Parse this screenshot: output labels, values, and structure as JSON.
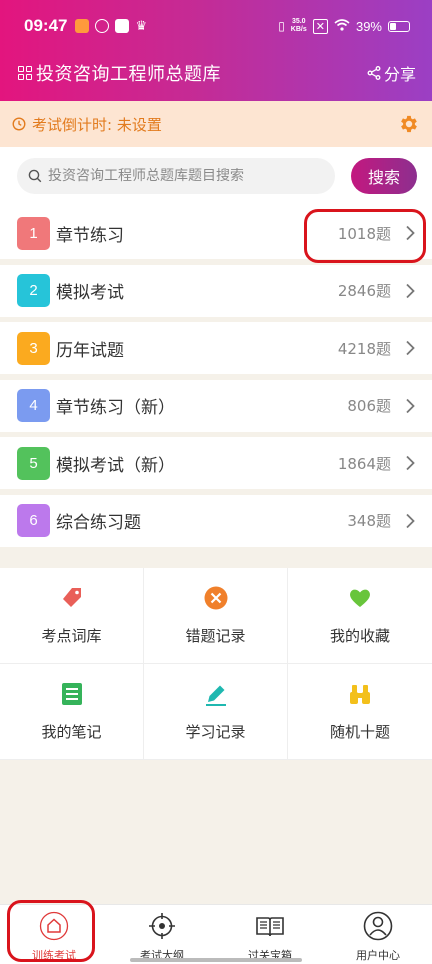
{
  "status_bar": {
    "time": "09:47",
    "net_speed_top": "35.0",
    "net_speed_bottom": "KB/s",
    "battery": "39%"
  },
  "app_bar": {
    "title": "投资咨询工程师总题库",
    "share_label": "分享"
  },
  "countdown": {
    "text": "考试倒计时: 未设置"
  },
  "search": {
    "placeholder": "投资咨询工程师总题库题目搜索",
    "button_label": "搜索"
  },
  "menu": {
    "items": [
      {
        "number": "1",
        "label": "章节练习",
        "count": "1018题",
        "color": "#f0787a"
      },
      {
        "number": "2",
        "label": "模拟考试",
        "count": "2846题",
        "color": "#26c4d9"
      },
      {
        "number": "3",
        "label": "历年试题",
        "count": "4218题",
        "color": "#fbaa1f"
      },
      {
        "number": "4",
        "label": "章节练习（新）",
        "count": "806题",
        "color": "#7b9bf0"
      },
      {
        "number": "5",
        "label": "模拟考试（新）",
        "count": "1864题",
        "color": "#53c25c"
      },
      {
        "number": "6",
        "label": "综合练习题",
        "count": "348题",
        "color": "#bc79ec"
      }
    ]
  },
  "tools": {
    "items": [
      {
        "label": "考点词库",
        "icon": "tag-icon"
      },
      {
        "label": "错题记录",
        "icon": "wrong-x-icon"
      },
      {
        "label": "我的收藏",
        "icon": "heart-icon"
      },
      {
        "label": "我的笔记",
        "icon": "notes-icon"
      },
      {
        "label": "学习记录",
        "icon": "pencil-icon"
      },
      {
        "label": "随机十题",
        "icon": "binoculars-icon"
      }
    ]
  },
  "tabbar": {
    "items": [
      {
        "label": "训练考试",
        "icon": "home-icon",
        "active": true
      },
      {
        "label": "考试大纲",
        "icon": "target-icon"
      },
      {
        "label": "过关宝箱",
        "icon": "book-icon"
      },
      {
        "label": "用户中心",
        "icon": "user-icon"
      }
    ]
  },
  "colors": {
    "accent": "#e3157e",
    "countdown_text": "#e27b1e",
    "highlight": "#d9141c",
    "active_tab": "#e03a3a"
  }
}
